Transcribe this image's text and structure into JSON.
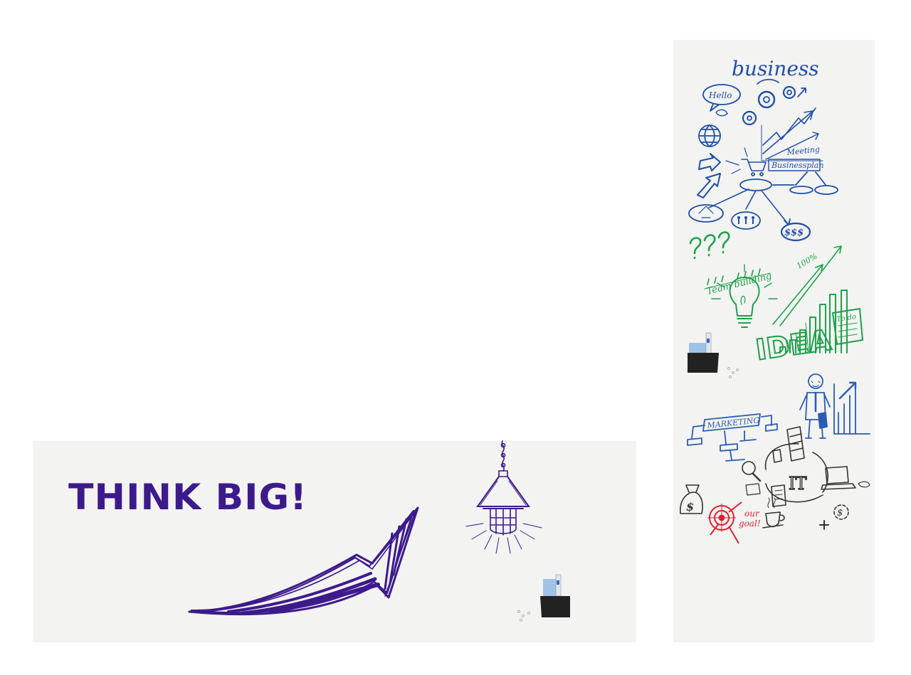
{
  "main_panel": {
    "headline": "THINK BIG!",
    "accent_color": "#3d1a8c",
    "icons": [
      "arrow-up-right-icon",
      "hanging-lamp-icon",
      "desk-organizer-icon"
    ]
  },
  "side_panel": {
    "business": {
      "title": "business",
      "bubble": "Hello",
      "meeting": "Meeting",
      "plan": "Businessplan",
      "money": "$$$",
      "color": "#1f4fa8"
    },
    "idea": {
      "team": "Team building",
      "percent": "100%",
      "word": "IDEA",
      "todo": "To do",
      "color": "#1fa04a"
    },
    "marketing": {
      "label": "MARKETING",
      "color": "#2a5db0"
    },
    "it": {
      "label": "IT",
      "goal_line1": "our",
      "goal_line2": "goal!",
      "goal_color": "#e02030",
      "color": "#333333"
    }
  }
}
